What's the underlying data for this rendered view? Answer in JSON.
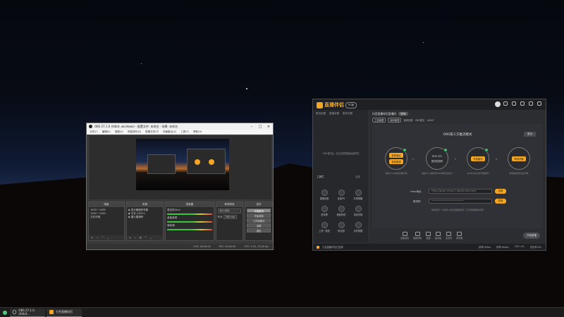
{
  "obs": {
    "title": "OBS 27.1.0 (64bit, windows) - 配置文件: 未命名 - 场景: 未命名",
    "menu": [
      "文件(F)",
      "编辑(E)",
      "视图(V)",
      "停靠部件(D)",
      "配置文件(P)",
      "场景集合(S)",
      "工具(T)",
      "帮助(H)"
    ],
    "docks": {
      "scenes": {
        "title": "场景",
        "items": [
          "1920 * 1080",
          "1440 * 1440",
          "文件存储"
        ]
      },
      "sources": {
        "title": "来源",
        "items": [
          "显示器捕获采集",
          "文本 (GDI+)",
          "图片置捕获"
        ]
      },
      "mixer": {
        "title": "混音器",
        "channels": [
          "麦克风/Aux",
          "桌面音频",
          "媒体源"
        ]
      },
      "transitions": {
        "title": "转场特效",
        "name": "淡入淡出",
        "duration_label": "时长",
        "duration": "300 ms"
      },
      "controls": {
        "title": "控件",
        "buttons": [
          "开始推流",
          "开始录制",
          "工作室模式",
          "设置",
          "退出"
        ]
      }
    },
    "status": [
      "LIVE: 00:00:00",
      "REC: 00:00:00",
      "CPU: 3.4%, 30.00 fps"
    ]
  },
  "helper": {
    "brand": "直播伴侣",
    "version": "PC版",
    "left_tabs": [
      "推流设置",
      "直播设置",
      "更多设置"
    ],
    "left_empty": "OBS推流后, 在此查看直播画面预览",
    "tools_label": "工具栏",
    "tools_more": "全部",
    "tools": [
      "直播设置",
      "连麦PK",
      "礼物提醒",
      "说说榜",
      "美颜特效",
      "场景切换",
      "上热一键发",
      "粉丝团",
      "实时数据"
    ],
    "room_title": "抖音直播伴侣直播间",
    "room_tag": "更新",
    "sub_chips": [
      "工具管理",
      "房间管理"
    ],
    "sub_info": [
      "音频设置",
      "OBS推流",
      "1080P"
    ],
    "mode_title": "OBS第三方推流模式",
    "mode_button": "退出",
    "steps": [
      {
        "buttons": [
          "复制地址",
          "复制密钥"
        ],
        "caption": "复制rtmp地址和推流码"
      },
      {
        "buttons": [
          "RMS URL",
          "推流密钥码"
        ],
        "caption": "粘贴rtmp推流到OBS推流设置中"
      },
      {
        "buttons": [
          "开始推流"
        ],
        "caption": "在OBS中点击开始推流"
      },
      {
        "buttons": [
          "等待开播"
        ],
        "caption": "等待推流成功后开播"
      }
    ],
    "fields": [
      {
        "label": "rtmp地址",
        "value": "rtmp://push-rtmp-l1.douyincdn.com/",
        "button": "复制"
      },
      {
        "label": "推流码",
        "value": "••••••••••••••••••••••",
        "button": "复制"
      }
    ],
    "hint": "推流码仅一次有效,请勿泄露推流码,下次开播需重新获取",
    "bottom_tools": [
      "直播设置",
      "美颜特效",
      "截图",
      "画中画",
      "麦克风",
      "扬声器"
    ],
    "start_button": "开始直播",
    "status_text": "七色直播伴侣已连接",
    "status_stats": [
      "帧率:30fps",
      "码率:0kbps",
      "CPU: 4%",
      "丢包率:0%"
    ]
  },
  "taskbar": {
    "items": [
      {
        "label": "OBS 27.1.0 (64bit...",
        "color": "#1b1b1b"
      },
      {
        "label": "七色直播伴侣",
        "color": "#f5a623"
      }
    ]
  }
}
